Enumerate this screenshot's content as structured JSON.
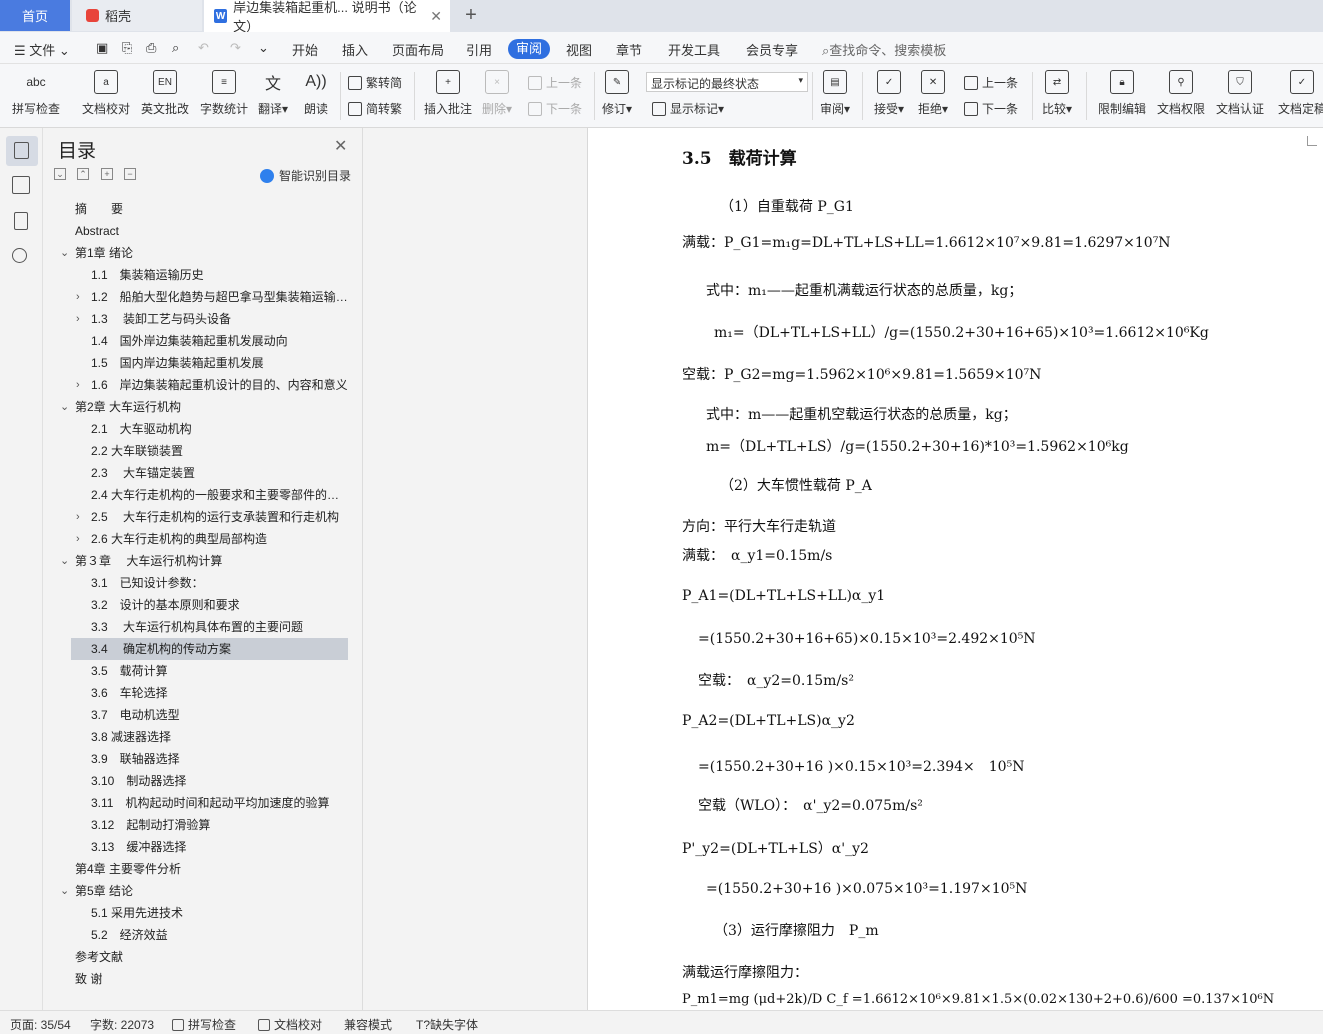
{
  "tabs": {
    "home": "首页",
    "daoke": "稻壳",
    "document": "岸边集装箱起重机... 说明书（论文）",
    "document_icon": "W",
    "close": "✕",
    "new": "+"
  },
  "menu": {
    "file": "文件",
    "items": [
      "开始",
      "插入",
      "页面布局",
      "引用",
      "审阅",
      "视图",
      "章节",
      "开发工具",
      "会员专享"
    ],
    "active": "审阅",
    "search": "查找命令、搜索模板"
  },
  "ribbon": {
    "spell_check": "拼写检查",
    "proofread": "文档校对",
    "english_review": "英文批改",
    "word_count": "字数统计",
    "translate": "翻译",
    "read_aloud": "朗读",
    "trad_to_simp": "繁转简",
    "simp_to_trad": "简转繁",
    "insert_comment": "插入批注",
    "delete": "删除",
    "prev_comment": "上一条",
    "next_comment": "下一条",
    "track_changes": "修订",
    "markup_state": "显示标记的最终状态",
    "show_markup": "显示标记",
    "review": "审阅",
    "accept": "接受",
    "reject": "拒绝",
    "prev_change": "上一条",
    "next_change": "下一条",
    "compare": "比较",
    "restrict_edit": "限制编辑",
    "doc_permission": "文档权限",
    "doc_cert": "文档认证",
    "doc_final": "文档定稿"
  },
  "toc": {
    "title": "目录",
    "smart": "智能识别目录",
    "items": [
      {
        "label": "摘　　要",
        "indent": 0,
        "arrow": ""
      },
      {
        "label": "Abstract",
        "indent": 0,
        "arrow": ""
      },
      {
        "label": "第1章 绪论",
        "indent": 0,
        "arrow": "v"
      },
      {
        "label": "1.1　集装箱运输历史",
        "indent": 1,
        "arrow": ""
      },
      {
        "label": "1.2　船舶大型化趋势与超巴拿马型集装箱运输船...",
        "indent": 1,
        "arrow": ">"
      },
      {
        "label": "1.3　 装卸工艺与码头设备",
        "indent": 1,
        "arrow": ">"
      },
      {
        "label": "1.4　国外岸边集装箱起重机发展动向",
        "indent": 1,
        "arrow": ""
      },
      {
        "label": "1.5　国内岸边集装箱起重机发展",
        "indent": 1,
        "arrow": ""
      },
      {
        "label": "1.6　岸边集装箱起重机设计的目的、内容和意义",
        "indent": 1,
        "arrow": ">"
      },
      {
        "label": "第2章 大车运行机构",
        "indent": 0,
        "arrow": "v"
      },
      {
        "label": "2.1　大车驱动机构",
        "indent": 1,
        "arrow": ""
      },
      {
        "label": "2.2 大车联锁装置",
        "indent": 1,
        "arrow": ""
      },
      {
        "label": "2.3　 大车锚定装置",
        "indent": 1,
        "arrow": ""
      },
      {
        "label": "2.4 大车行走机构的一般要求和主要零部件的选择",
        "indent": 1,
        "arrow": ""
      },
      {
        "label": "2.5　 大车行走机构的运行支承装置和行走机构",
        "indent": 1,
        "arrow": ">"
      },
      {
        "label": "2.6 大车行走机构的典型局部构造",
        "indent": 1,
        "arrow": ">"
      },
      {
        "label": "第３章　 大车运行机构计算",
        "indent": 0,
        "arrow": "v"
      },
      {
        "label": "3.1　已知设计参数：",
        "indent": 1,
        "arrow": ""
      },
      {
        "label": "3.2　设计的基本原则和要求",
        "indent": 1,
        "arrow": ""
      },
      {
        "label": "3.3　 大车运行机构具体布置的主要问题",
        "indent": 1,
        "arrow": ""
      },
      {
        "label": "3.4　 确定机构的传动方案",
        "indent": 1,
        "arrow": "",
        "selected": true
      },
      {
        "label": "3.5　载荷计算",
        "indent": 1,
        "arrow": ""
      },
      {
        "label": "3.6　车轮选择",
        "indent": 1,
        "arrow": ""
      },
      {
        "label": "3.7　电动机选型",
        "indent": 1,
        "arrow": ""
      },
      {
        "label": "3.8 减速器选择",
        "indent": 1,
        "arrow": ""
      },
      {
        "label": "3.9　联轴器选择",
        "indent": 1,
        "arrow": ""
      },
      {
        "label": "3.10　制动器选择",
        "indent": 1,
        "arrow": ""
      },
      {
        "label": "3.11　机构起动时间和起动平均加速度的验算",
        "indent": 1,
        "arrow": ""
      },
      {
        "label": "3.12　起制动打滑验算",
        "indent": 1,
        "arrow": ""
      },
      {
        "label": "3.13　缓冲器选择",
        "indent": 1,
        "arrow": ""
      },
      {
        "label": "第4章 主要零件分析",
        "indent": 0,
        "arrow": ""
      },
      {
        "label": "第5章 结论",
        "indent": 0,
        "arrow": "v"
      },
      {
        "label": "5.1 采用先进技术",
        "indent": 1,
        "arrow": ""
      },
      {
        "label": "5.2　经济效益",
        "indent": 1,
        "arrow": ""
      },
      {
        "label": "参考文献",
        "indent": 0,
        "arrow": ""
      },
      {
        "label": "致 谢",
        "indent": 0,
        "arrow": ""
      }
    ]
  },
  "document": {
    "heading": "3.5　载荷计算",
    "lines": [
      "（1）自重载荷 P_G1",
      "满载：P_G1=m₁g=DL+TL+LS+LL=1.6612×10⁷×9.81=1.6297×10⁷N",
      "式中：m₁——起重机满载运行状态的总质量，kg；",
      "m₁=（DL+TL+LS+LL）/g=(1550.2+30+16+65)×10³=1.6612×10⁶Kg",
      "空载：P_G2=mg=1.5962×10⁶×9.81=1.5659×10⁷N",
      "式中：m——起重机空载运行状态的总质量，kg；",
      "m=（DL+TL+LS）/g=(1550.2+30+16)*10³=1.5962×10⁶kg",
      "（2）大车惯性载荷 P_A",
      "方向：平行大车行走轨道",
      "满载：　α_y1=0.15m/s",
      "P_A1=(DL+TL+LS+LL)α_y1",
      "=(1550.2+30+16+65)×0.15×10³=2.492×10⁵N",
      "空载：　α_y2=0.15m/s²",
      "P_A2=(DL+TL+LS)α_y2",
      "=(1550.2+30+16 )×0.15×10³=2.394×　10⁵N",
      "空载（WLO）：　α'_y2=0.075m/s²",
      "P'_y2=(DL+TL+LS）α'_y2",
      "=(1550.2+30+16 )×0.075×10³=1.197×10⁵N",
      "（3）运行摩擦阻力　P_m",
      "满载运行摩擦阻力：",
      "P_m1=mg (μd+2k)/D C_f =1.6612×10⁶×9.81×1.5×(0.02×130+2+0.6)/600 =0.137×10⁶N"
    ]
  },
  "status": {
    "page": "页面: 35/54",
    "words": "字数: 22073",
    "spell": "拼写检查",
    "proof": "文档校对",
    "compat": "兼容模式",
    "missing_font": "缺失字体"
  }
}
